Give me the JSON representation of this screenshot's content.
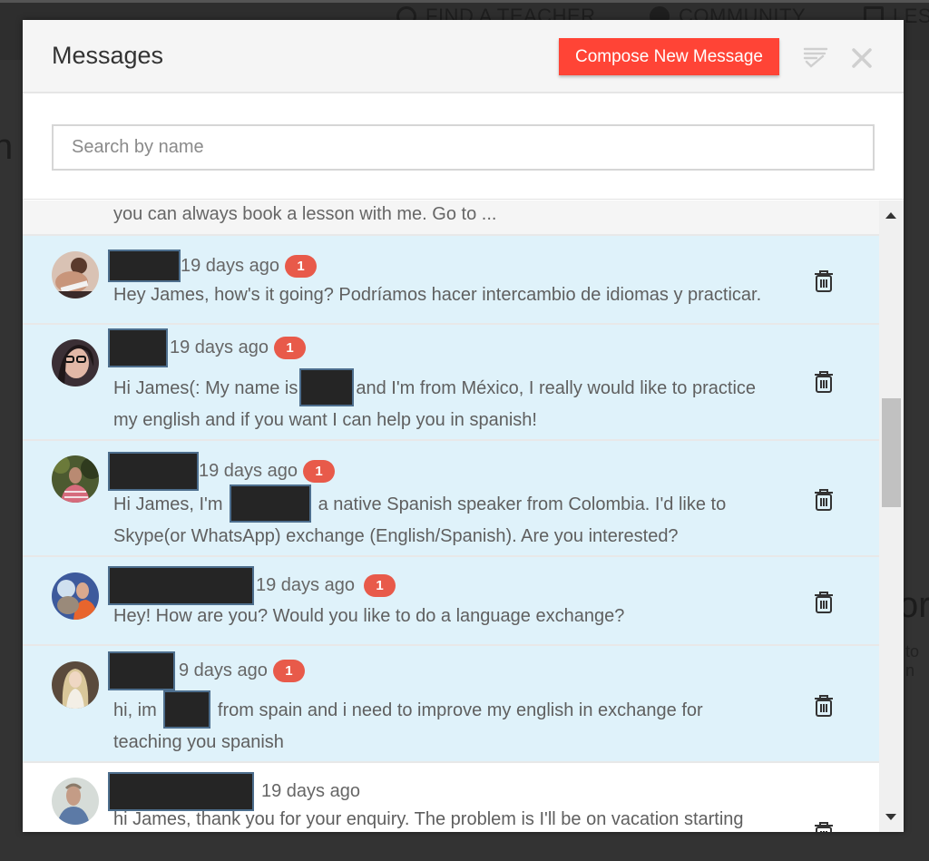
{
  "background": {
    "nav_items": [
      {
        "label": "FIND A TEACHER",
        "icon": "search-icon"
      },
      {
        "label": "COMMUNITY",
        "icon": "globe-icon"
      },
      {
        "label": "LES",
        "icon": "lessons-icon"
      }
    ],
    "fragments": [
      "n",
      "or",
      "to n"
    ]
  },
  "modal": {
    "title": "Messages",
    "compose_label": "Compose New Message",
    "mark_read_icon": "mark-all-read-icon",
    "close_icon": "close-icon",
    "accent_color": "#ff4436",
    "search": {
      "placeholder": "Search by name",
      "value": ""
    },
    "partial_message_text": "you can always book a lesson with me. Go to ...",
    "messages": [
      {
        "time": "19 days ago",
        "unread_count": "1",
        "unread": true,
        "body": [
          "Hey James, how's it going? Podríamos hacer intercambio de idiomas y practicar."
        ]
      },
      {
        "time": "19 days ago",
        "unread_count": "1",
        "unread": true,
        "body_parts": [
          "Hi James(: My name is",
          "and I'm from México, I really would like to practice"
        ],
        "body_line2": "my english and if you want I can help you in spanish!"
      },
      {
        "time": "19 days ago",
        "unread_count": "1",
        "unread": true,
        "body_parts": [
          "Hi James, I'm",
          "a native Spanish speaker from Colombia. I'd like to"
        ],
        "body_line2": "Skype(or WhatsApp) exchange (English/Spanish). Are you interested?"
      },
      {
        "time": "19 days ago",
        "unread_count": "1",
        "unread": true,
        "body": [
          "Hey! How are you? Would you like to do a language exchange?"
        ]
      },
      {
        "time": "9 days ago",
        "unread_count": "1",
        "unread": true,
        "body_parts": [
          "hi, im",
          "from spain and i need to improve my english in exchange for"
        ],
        "body_line2": "teaching you spanish"
      },
      {
        "time": "19 days ago",
        "unread": false,
        "body": [
          "hi James, thank you for your enquiry. The problem is I'll be on vacation starting"
        ]
      }
    ],
    "scroll_position": 0.42
  }
}
